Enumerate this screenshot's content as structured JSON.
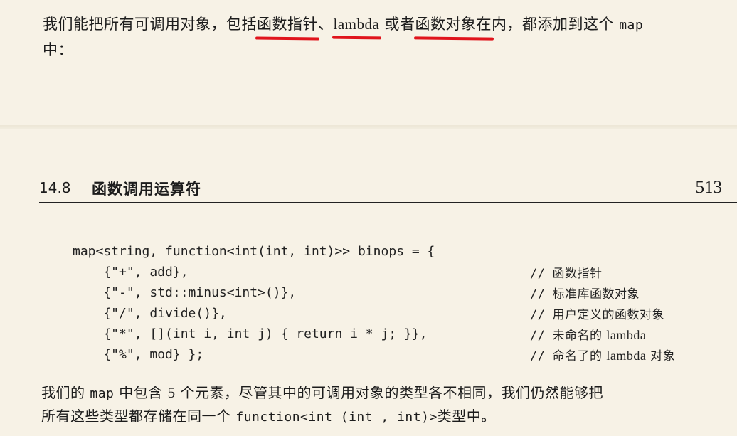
{
  "intro": {
    "part1": "我们能把所有可调用对象，包括",
    "hl1": "函数指针",
    "sep1": "、",
    "hl2": "lambda",
    "sep2": " 或者",
    "hl3": "函数对象在",
    "part2": "内，都添加到这个 ",
    "code_map": "map",
    "line2": "中："
  },
  "section": {
    "number": "14.8",
    "title": "函数调用运算符",
    "page": "513"
  },
  "code": {
    "lines": [
      "map<string, function<int(int, int)>> binops = {",
      "    {\"+\", add},",
      "    {\"-\", std::minus<int>()},",
      "    {\"/\", divide()},",
      "    {\"*\", [](int i, int j) { return i * j; }},",
      "    {\"%\", mod} };"
    ],
    "comment_slash": "//",
    "comments": [
      "函数指针",
      "标准库函数对象",
      "用户定义的函数对象",
      "未命名的",
      "命名了的"
    ],
    "lambda_word": "lambda",
    "object_word": " 对象"
  },
  "outro": {
    "l1a": "我们的 ",
    "l1_map": "map",
    "l1b": " 中包含 ",
    "l1_num": "5",
    "l1c": " 个元素，尽管其中的可调用对象的类型各不相同，我们仍然能够把",
    "l2a": "所有这些类型都存储在同一个 ",
    "l2_code": "function<int (int , int)>",
    "l2b": "类型中。"
  }
}
